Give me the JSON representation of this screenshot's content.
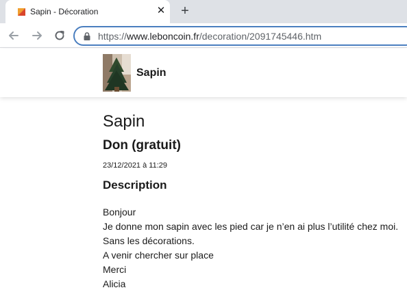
{
  "browser": {
    "tab_title": "Sapin - Décoration",
    "tab_close": "✕",
    "new_tab": "+",
    "url_prefix": "https://",
    "url_host": "www.leboncoin.fr",
    "url_path": "/decoration/2091745446.htm"
  },
  "header": {
    "title": "Sapin"
  },
  "ad": {
    "title": "Sapin",
    "price": "Don (gratuit)",
    "date": "23/12/2021 à 11:29",
    "description_heading": "Description",
    "description_lines": [
      "Bonjour",
      "Je donne mon sapin avec les pied car je n’en ai plus l’utilité chez moi.",
      "Sans les décorations.",
      "A venir chercher sur place",
      "Merci",
      "Alicia"
    ]
  }
}
